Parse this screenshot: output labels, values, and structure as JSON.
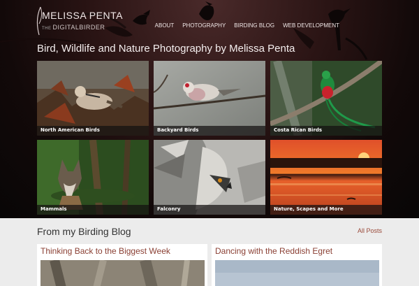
{
  "header": {
    "logo_name": "MELISSA PENTA",
    "logo_sub_prefix": "THE",
    "logo_sub": "DIGITALBIRDER",
    "nav": [
      "ABOUT",
      "PHOTOGRAPHY",
      "BIRDING BLOG",
      "WEB DEVELOPMENT"
    ]
  },
  "hero": {
    "headline": "Bird, Wildlife and Nature Photography by Melissa Penta"
  },
  "gallery": [
    {
      "label": "North American Birds"
    },
    {
      "label": "Backyard Birds"
    },
    {
      "label": "Costa Rican Birds"
    },
    {
      "label": "Mammals"
    },
    {
      "label": "Falconry"
    },
    {
      "label": "Nature, Scapes and More"
    }
  ],
  "blog": {
    "title": "From my Birding Blog",
    "all_posts": "All Posts",
    "posts": [
      {
        "title": "Thinking Back to the Biggest Week"
      },
      {
        "title": "Dancing with the Reddish Egret"
      }
    ]
  },
  "colors": {
    "accent": "#8a3f33",
    "hero_bg": "#120909",
    "page_bg": "#ececec"
  }
}
